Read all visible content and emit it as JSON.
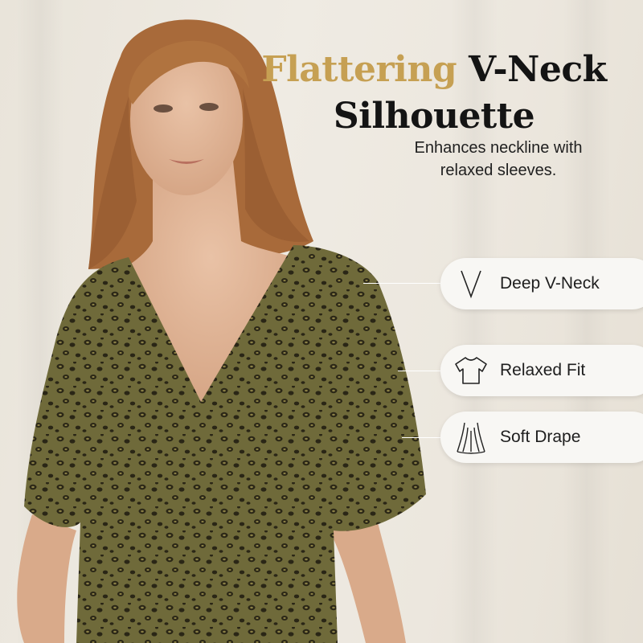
{
  "headline": {
    "accent_word": "Flattering",
    "line1_rest": "V-Neck",
    "line2": "Silhouette",
    "accent_color": "#c6a053"
  },
  "subheading": {
    "line1": "Enhances neckline with",
    "line2": "relaxed sleeves."
  },
  "features": [
    {
      "label": "Deep V-Neck",
      "icon": "v-neck-icon"
    },
    {
      "label": "Relaxed Fit",
      "icon": "t-shirt-icon"
    },
    {
      "label": "Soft Drape",
      "icon": "drape-icon"
    }
  ],
  "colors": {
    "background": "#ece7de",
    "pill_background": "#f8f7f4",
    "garment_base": "#6f6a3a",
    "hair": "#a86a3a"
  }
}
